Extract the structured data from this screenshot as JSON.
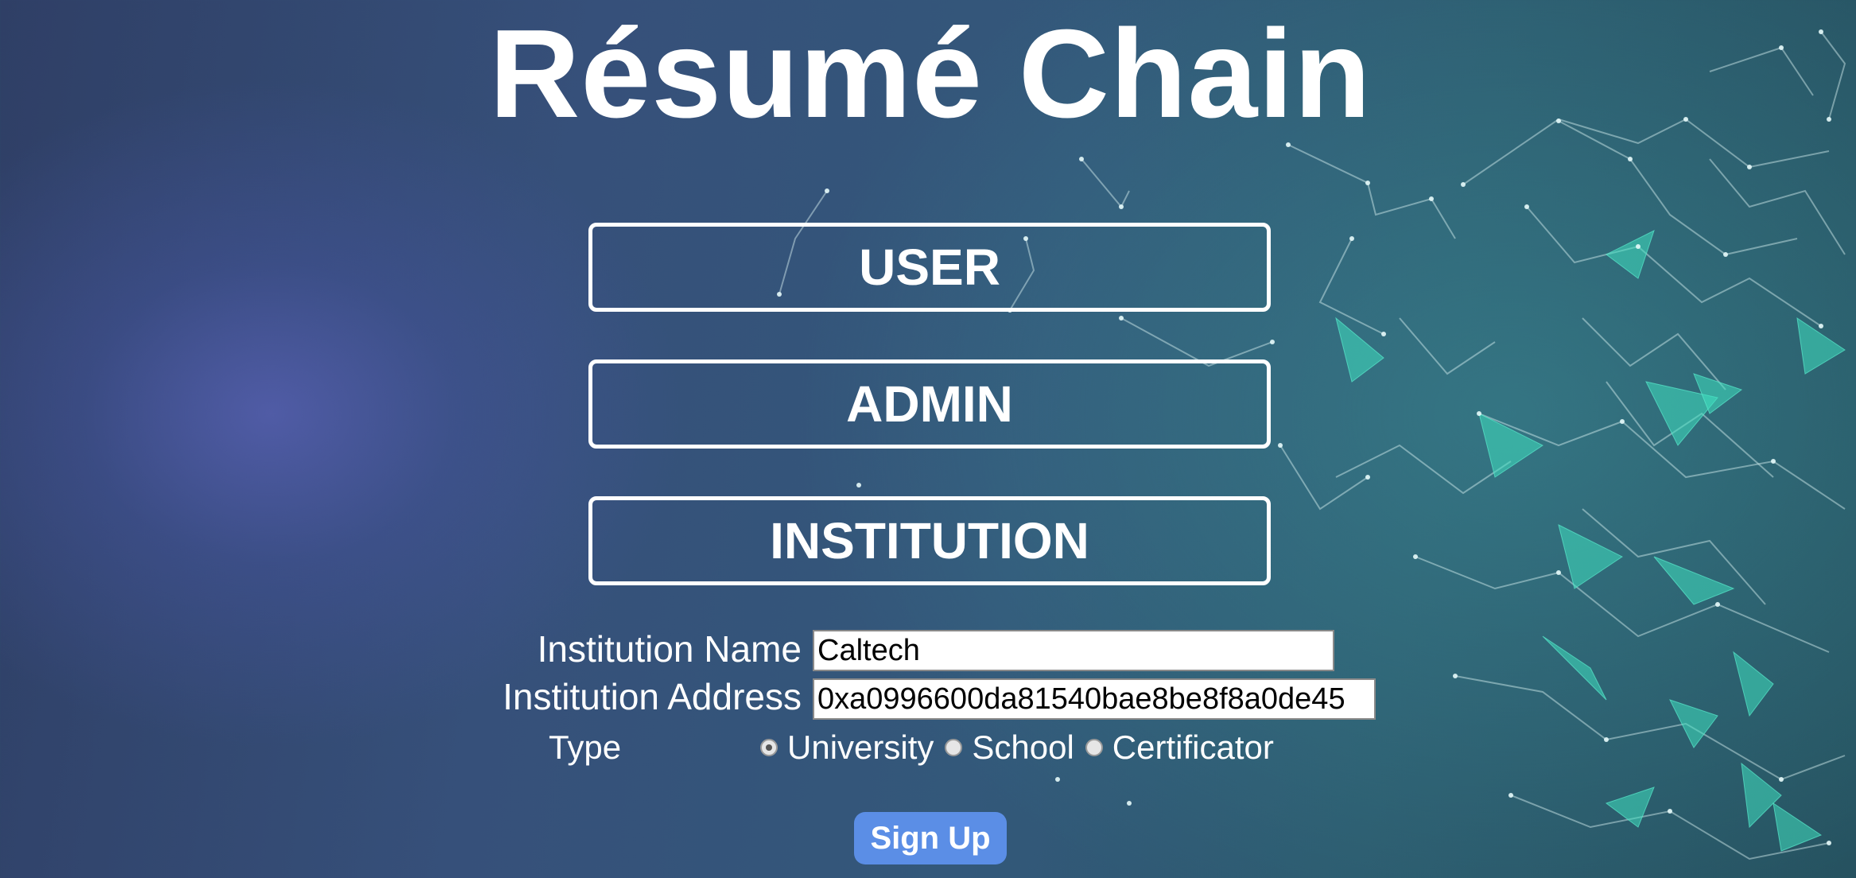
{
  "app": {
    "title": "Résumé Chain"
  },
  "roles": {
    "user_label": "USER",
    "admin_label": "ADMIN",
    "institution_label": "INSTITUTION"
  },
  "form": {
    "name_label": "Institution Name",
    "name_value": "Caltech",
    "address_label": "Institution Address",
    "address_value": "0xa0996600da81540bae8be8f8a0de45",
    "type_label": "Type",
    "type_options": [
      {
        "label": "University",
        "selected": true
      },
      {
        "label": "School",
        "selected": false
      },
      {
        "label": "Certificator",
        "selected": false
      }
    ],
    "submit_label": "Sign Up"
  },
  "colors": {
    "accent_button": "#5b8ee6",
    "network_node": "#dff3f3",
    "network_fill": "#3fe0c0"
  }
}
